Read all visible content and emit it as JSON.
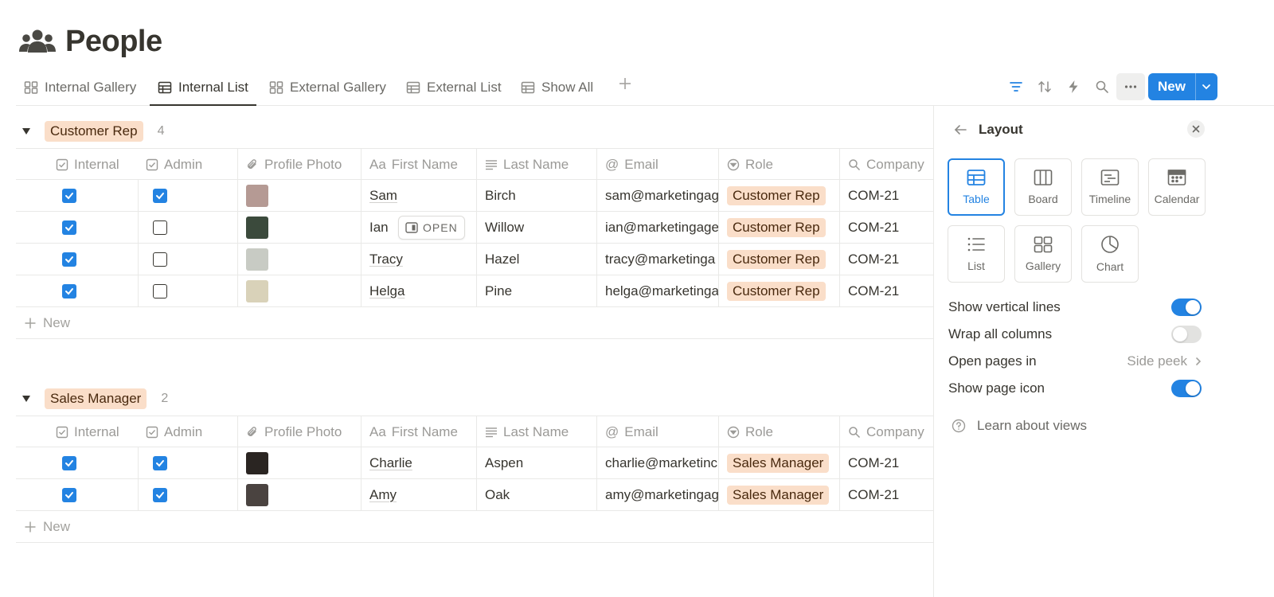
{
  "page": {
    "title": "People",
    "icon": "people-icon"
  },
  "tabs": [
    {
      "label": "Internal Gallery",
      "icon": "gallery-icon",
      "active": false
    },
    {
      "label": "Internal List",
      "icon": "table-icon",
      "active": true
    },
    {
      "label": "External Gallery",
      "icon": "gallery-icon",
      "active": false
    },
    {
      "label": "External List",
      "icon": "table-icon",
      "active": false
    },
    {
      "label": "Show All",
      "icon": "table-icon",
      "active": false
    }
  ],
  "toolbar": {
    "new_label": "New"
  },
  "columns": [
    {
      "label": "Internal",
      "icon": "checkbox-icon"
    },
    {
      "label": "Admin",
      "icon": "checkbox-icon"
    },
    {
      "label": "Profile Photo",
      "icon": "paperclip-icon"
    },
    {
      "label": "First Name",
      "icon": "text-aa-icon",
      "icon_text": "Aa"
    },
    {
      "label": "Last Name",
      "icon": "lines-icon"
    },
    {
      "label": "Email",
      "icon": "at-icon",
      "icon_text": "@"
    },
    {
      "label": "Role",
      "icon": "select-icon"
    },
    {
      "label": "Company",
      "icon": "search-icon"
    }
  ],
  "groups": [
    {
      "name": "Customer Rep",
      "count": "4",
      "rows": [
        {
          "internal": true,
          "admin": true,
          "first": "Sam",
          "last": "Birch",
          "email": "sam@marketingag",
          "role": "Customer Rep",
          "company": "COM-21",
          "avatar_color": "#b59a94"
        },
        {
          "internal": true,
          "admin": false,
          "first": "Ian",
          "last": "Willow",
          "email": "ian@marketingage",
          "role": "Customer Rep",
          "company": "COM-21",
          "avatar_color": "#3b4a3c",
          "hover_open": "OPEN"
        },
        {
          "internal": true,
          "admin": false,
          "first": "Tracy",
          "last": "Hazel",
          "email": "tracy@marketinga",
          "role": "Customer Rep",
          "company": "COM-21",
          "avatar_color": "#c8cbc4"
        },
        {
          "internal": true,
          "admin": false,
          "first": "Helga",
          "last": "Pine",
          "email": "helga@marketinga",
          "role": "Customer Rep",
          "company": "COM-21",
          "avatar_color": "#d9d2b9"
        }
      ],
      "new_label": "New"
    },
    {
      "name": "Sales Manager",
      "count": "2",
      "rows": [
        {
          "internal": true,
          "admin": true,
          "first": "Charlie",
          "last": "Aspen",
          "email": "charlie@marketinc",
          "role": "Sales Manager",
          "company": "COM-21",
          "avatar_color": "#2a2522"
        },
        {
          "internal": true,
          "admin": true,
          "first": "Amy",
          "last": "Oak",
          "email": "amy@marketingag",
          "role": "Sales Manager",
          "company": "COM-21",
          "avatar_color": "#4a4340"
        }
      ],
      "new_label": "New"
    }
  ],
  "panel": {
    "title": "Layout",
    "layouts": [
      {
        "label": "Table",
        "icon": "table-icon",
        "selected": true
      },
      {
        "label": "Board",
        "icon": "board-icon",
        "selected": false
      },
      {
        "label": "Timeline",
        "icon": "timeline-icon",
        "selected": false
      },
      {
        "label": "Calendar",
        "icon": "calendar-icon",
        "selected": false
      },
      {
        "label": "List",
        "icon": "list-icon",
        "selected": false
      },
      {
        "label": "Gallery",
        "icon": "gallery-icon",
        "selected": false
      },
      {
        "label": "Chart",
        "icon": "chart-icon",
        "selected": false
      }
    ],
    "options": {
      "vertical_lines": {
        "label": "Show vertical lines",
        "on": true
      },
      "wrap_columns": {
        "label": "Wrap all columns",
        "on": false
      },
      "open_pages": {
        "label": "Open pages in",
        "value": "Side peek"
      },
      "page_icon": {
        "label": "Show page icon",
        "on": true
      }
    },
    "learn_label": "Learn about views"
  },
  "colors": {
    "accent": "#2383e2",
    "role_pill_bg": "#fadec9",
    "role_pill_text": "#49290e"
  }
}
